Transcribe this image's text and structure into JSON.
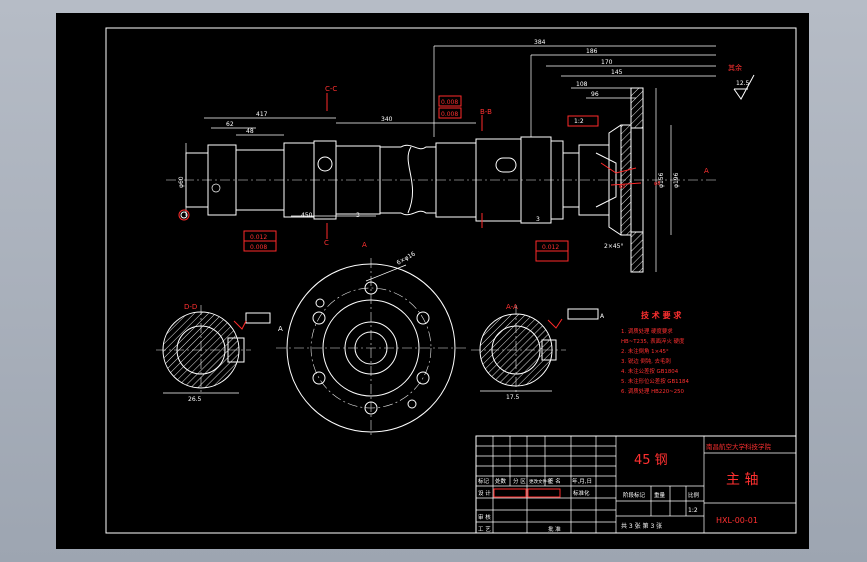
{
  "drawing": {
    "material": "45 钢",
    "school": "南昌航空大学科技学院",
    "part_name": "主 轴",
    "drawing_no": "HXL-00-01",
    "scale": "1:2",
    "sheets": "共 3 张  第 3 张",
    "roughness_note": "其余",
    "roughness_value": "12.5"
  },
  "title_block": {
    "labels": [
      "标记",
      "处数",
      "分 区",
      "更改文件号",
      "签 名",
      "年,月,日"
    ],
    "row2": [
      "设 计",
      "标准化"
    ],
    "row3": [
      "审 核"
    ],
    "row4": [
      "工 艺",
      "批 准"
    ],
    "stage_labels": [
      "阶段标记",
      "重量",
      "比例"
    ]
  },
  "tech_req": {
    "title": "技 术 要 求",
    "lines": [
      "1. 调质处理 硬度要求",
      "   HB~T235, 表面淬火 硬度",
      "2. 未注倒角 1×45°",
      "3. 锐边 倒钝, 去毛刺",
      "4. 未注公差按 GB1804",
      "5. 未注形位公差按 GB1184",
      "6. 调质处理 HB220~250"
    ]
  },
  "dims": {
    "overall": "384",
    "d1": "186",
    "d2": "170",
    "d3": "145",
    "d4": "108",
    "d5": "96",
    "shaft_len": "340",
    "left_len": "417",
    "seg1": "62",
    "seg2": "48",
    "left_dia": "φ60",
    "flange_dia": "φ196",
    "flange_dia2": "φ156",
    "hole_note": "6×φ16",
    "chamfer": "2×45°",
    "ratio": "1:2",
    "bottom1": "450",
    "bottom2": "3",
    "bottom3": "3",
    "section_aa": "A-A",
    "section_bb": "B-B",
    "section_cc": "C-C",
    "section_dd": "D-D",
    "sec1_width": "26.5",
    "sec2_width": "17.5",
    "tol1": "0.008",
    "tol2": "0.008",
    "tol3": "0.012",
    "tol4": "0.008",
    "tol5": "0.012",
    "view_a": "A",
    "datum": "A"
  }
}
